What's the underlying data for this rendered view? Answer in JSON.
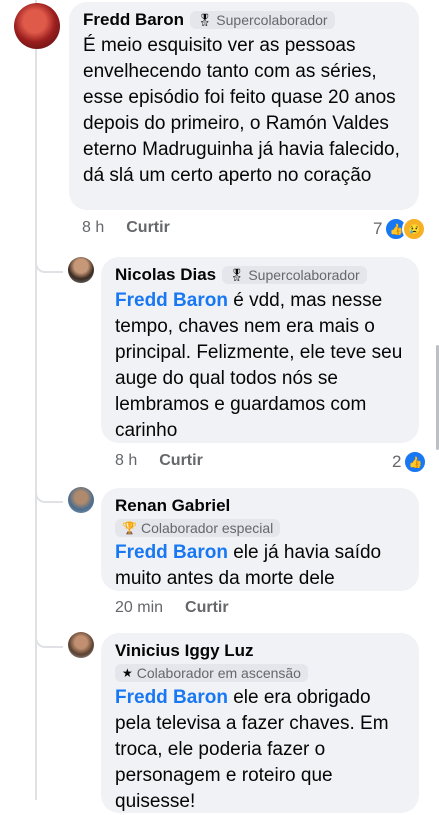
{
  "comments": [
    {
      "author": "Fredd Baron",
      "badge": "Supercolaborador",
      "badge_icon": "medal-icon",
      "mention": "",
      "text": "É meio esquisito ver as pessoas envelhecendo tanto com as séries, esse episódio foi feito quase 20 anos depois do primeiro, o Ramón Valdes eterno Madruguinha já havia falecido, dá slá um certo aperto no coração",
      "time": "8 h",
      "like_label": "Curtir",
      "reaction_count": "7",
      "reactions": [
        "like-icon",
        "sad-icon"
      ]
    },
    {
      "author": "Nicolas Dias",
      "badge": "Supercolaborador",
      "badge_icon": "medal-icon",
      "mention": "Fredd Baron",
      "text": " é vdd, mas nesse tempo, chaves nem era mais o principal. Felizmente, ele teve seu auge do qual todos nós se lembramos e guardamos com carinho",
      "time": "8 h",
      "like_label": "Curtir",
      "reaction_count": "2",
      "reactions": [
        "like-icon"
      ]
    },
    {
      "author": "Renan Gabriel",
      "badge": "Colaborador especial",
      "badge_icon": "trophy-icon",
      "mention": "Fredd Baron",
      "text": " ele já havia saído muito antes da morte dele",
      "time": "20 min",
      "like_label": "Curtir",
      "reaction_count": "",
      "reactions": []
    },
    {
      "author": "Vinicius Iggy Luz",
      "badge": "Colaborador em ascensão",
      "badge_icon": "star-icon",
      "mention": "Fredd Baron",
      "text": " ele era obrigado pela televisa a fazer chaves. Em troca, ele poderia fazer o personagem e roteiro que quisesse!",
      "time": "",
      "like_label": "",
      "reaction_count": "",
      "reactions": []
    }
  ],
  "colors": {
    "mention": "#1877f2",
    "bubble": "#f0f2f5",
    "like_reaction": "#1877f2",
    "sad_reaction": "#f7b125"
  }
}
